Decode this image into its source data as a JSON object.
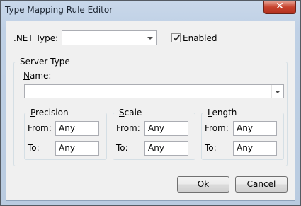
{
  "window": {
    "title": "Type Mapping Rule Editor",
    "close_glyph": "✕"
  },
  "net_type": {
    "label_prefix": ".NET ",
    "label_underlined": "T",
    "label_suffix": "ype:",
    "value": ""
  },
  "enabled": {
    "label_underlined": "E",
    "label_rest": "nabled",
    "checked": true
  },
  "server_type": {
    "group_title": "Server Type",
    "name_label_underlined": "N",
    "name_label_rest": "ame:",
    "name_value": ""
  },
  "precision": {
    "title_underlined": "P",
    "title_rest": "recision",
    "from_label": "From:",
    "from_value": "Any",
    "to_label": "To:",
    "to_value": "Any"
  },
  "scale": {
    "title_underlined": "S",
    "title_rest": "cale",
    "from_label": "From:",
    "from_value": "Any",
    "to_label": "To:",
    "to_value": "Any"
  },
  "length": {
    "title_underlined": "L",
    "title_rest": "ength",
    "from_label": "From:",
    "from_value": "Any",
    "to_label": "To:",
    "to_value": "Any"
  },
  "buttons": {
    "ok": "Ok",
    "cancel": "Cancel"
  }
}
